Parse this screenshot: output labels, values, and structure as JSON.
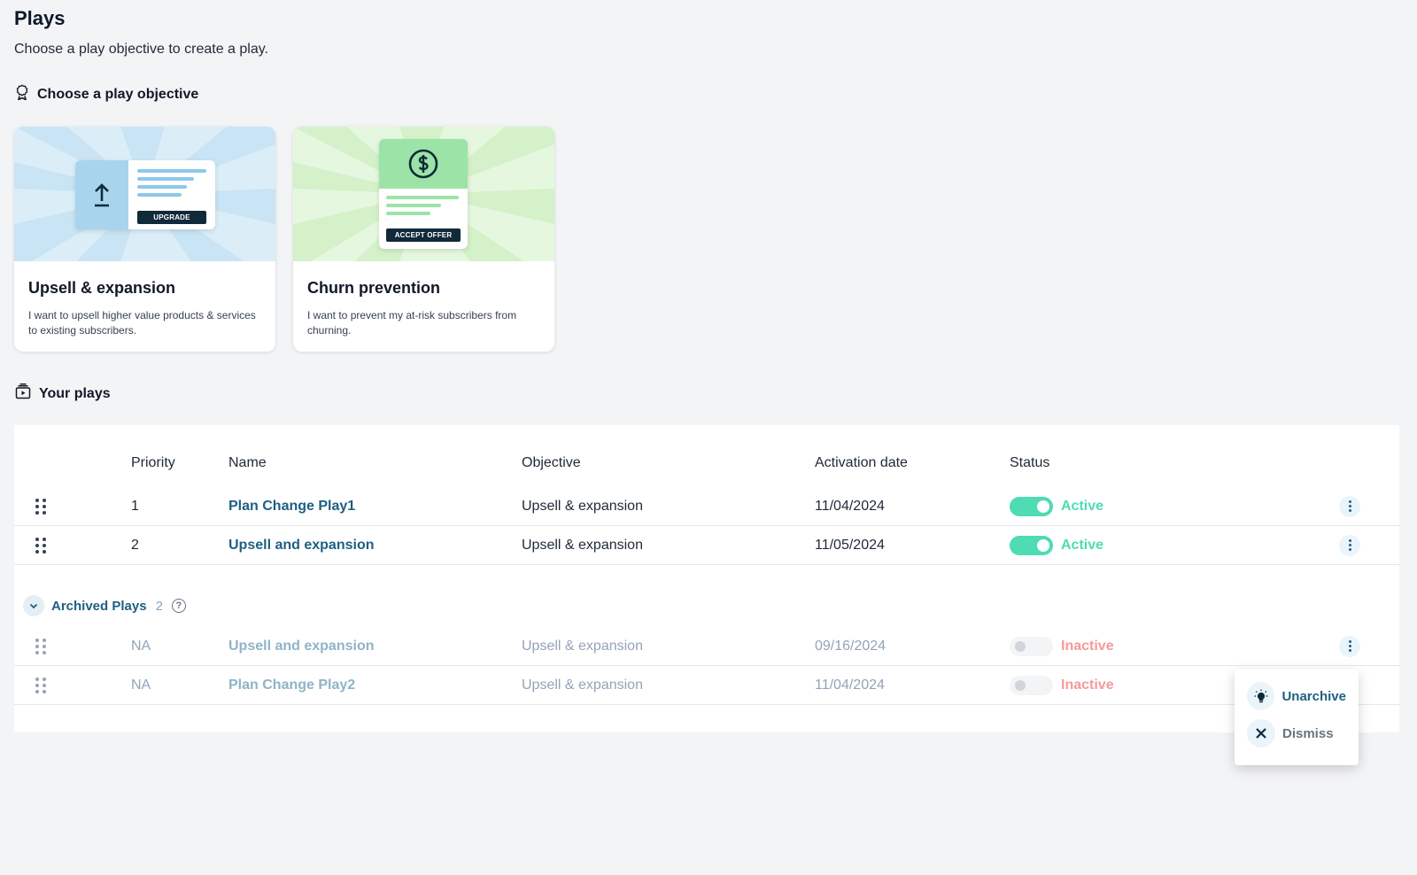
{
  "header": {
    "title": "Plays",
    "subtitle": "Choose a play objective to create a play."
  },
  "objective_section": {
    "heading": "Choose a play objective",
    "cards": [
      {
        "title": "Upsell & expansion",
        "description": "I want to upsell higher value products & services to existing subscribers.",
        "art_button": "UPGRADE"
      },
      {
        "title": "Churn prevention",
        "description": "I want to prevent my at-risk subscribers from churning.",
        "art_button": "ACCEPT OFFER"
      }
    ]
  },
  "plays_section": {
    "heading": "Your plays",
    "columns": {
      "priority": "Priority",
      "name": "Name",
      "objective": "Objective",
      "activation_date": "Activation date",
      "status": "Status"
    },
    "rows": [
      {
        "priority": "1",
        "name": "Plan Change Play1",
        "objective": "Upsell & expansion",
        "date": "11/04/2024",
        "status": "Active"
      },
      {
        "priority": "2",
        "name": "Upsell and expansion",
        "objective": "Upsell & expansion",
        "date": "11/05/2024",
        "status": "Active"
      }
    ],
    "archived": {
      "label": "Archived Plays",
      "count": "2",
      "help": "?",
      "rows": [
        {
          "priority": "NA",
          "name": "Upsell and expansion",
          "objective": "Upsell & expansion",
          "date": "09/16/2024",
          "status": "Inactive"
        },
        {
          "priority": "NA",
          "name": "Plan Change Play2",
          "objective": "Upsell & expansion",
          "date": "11/04/2024",
          "status": "Inactive"
        }
      ]
    }
  },
  "context_menu": {
    "unarchive": "Unarchive",
    "dismiss": "Dismiss"
  },
  "colors": {
    "accent": "#1f5f82",
    "active": "#4fdbb4",
    "inactive": "#f59a9a"
  },
  "icons": {
    "objective": "badge-icon",
    "plays": "play-stack-icon",
    "drag": "drag-handle-icon",
    "more": "kebab-icon",
    "unarchive": "lightbulb-icon",
    "dismiss": "close-icon"
  }
}
